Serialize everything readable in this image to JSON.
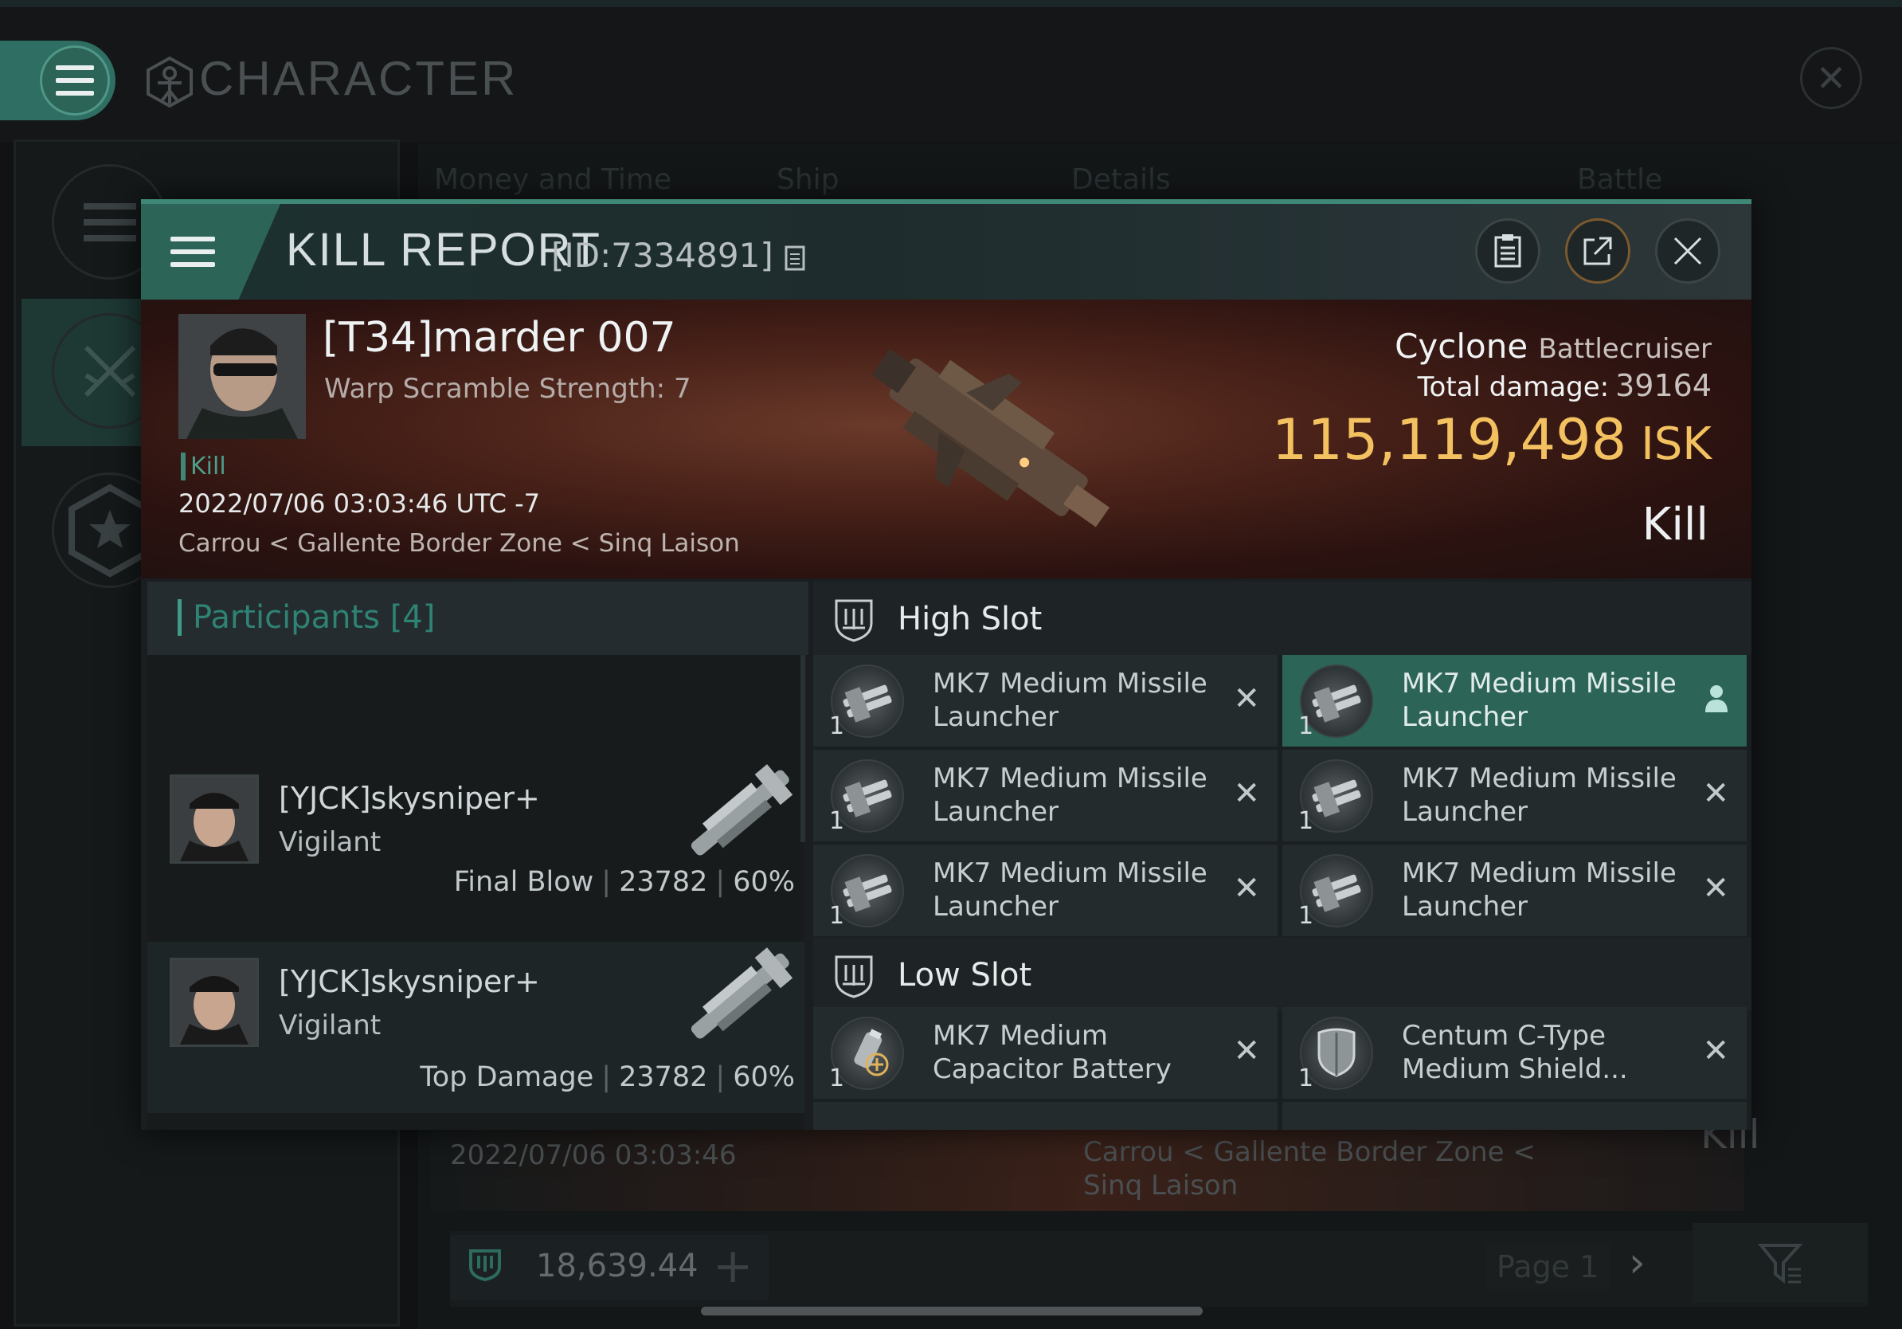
{
  "app": {
    "title": "CHARACTER"
  },
  "background": {
    "tabs": [
      "Money and Time",
      "Ship",
      "Details",
      "Battle Status"
    ],
    "row_date": "2022/07/06  03:03:46",
    "row_location": "Carrou < Gallente Border Zone < Sinq Laison",
    "row_result": "Kill",
    "wallet_value": "18,639.44",
    "page_label": "Page 1"
  },
  "kill_report": {
    "title": "KILL REPORT",
    "id_label": "[ID:7334891]",
    "victim": {
      "name": "[T34]marder 007",
      "warp_scramble": "Warp Scramble Strength: 7",
      "tag": "Kill",
      "datetime": "2022/07/06 03:03:46 UTC -7",
      "location": "Carrou < Gallente Border Zone < Sinq Laison"
    },
    "ship": {
      "name": "Cyclone",
      "class": "Battlecruiser",
      "total_damage_label": "Total damage:",
      "total_damage": "39164",
      "value": "115,119,498",
      "currency": "ISK",
      "result": "Kill"
    },
    "participants": {
      "label": "Participants",
      "count": "[4]",
      "rows": [
        {
          "name": "[YJCK]skysniper+",
          "ship": "Vigilant",
          "role": "Final Blow",
          "damage": "23782",
          "percent": "60%"
        },
        {
          "name": "[YJCK]skysniper+",
          "ship": "Vigilant",
          "role": "Top Damage",
          "damage": "23782",
          "percent": "60%"
        }
      ]
    },
    "high_slot": {
      "title": "High Slot",
      "items": [
        {
          "name": "MK7 Medium Missile Launcher",
          "qty": "1",
          "state": "dropped"
        },
        {
          "name": "MK7 Medium Missile Launcher",
          "qty": "1",
          "state": "selected"
        },
        {
          "name": "MK7 Medium Missile Launcher",
          "qty": "1",
          "state": "dropped"
        },
        {
          "name": "MK7 Medium Missile Launcher",
          "qty": "1",
          "state": "dropped"
        },
        {
          "name": "MK7 Medium Missile Launcher",
          "qty": "1",
          "state": "dropped"
        },
        {
          "name": "MK7 Medium Missile Launcher",
          "qty": "1",
          "state": "dropped"
        }
      ]
    },
    "low_slot": {
      "title": "Low Slot",
      "items": [
        {
          "name": "MK7 Medium Capacitor Battery",
          "qty": "1",
          "state": "dropped"
        },
        {
          "name": "Centum C-Type Medium Shield...",
          "qty": "1",
          "state": "dropped"
        }
      ]
    }
  },
  "colors": {
    "accent": "#3f8877",
    "isk": "#f3c15f",
    "selected_item": "#2d6458"
  }
}
